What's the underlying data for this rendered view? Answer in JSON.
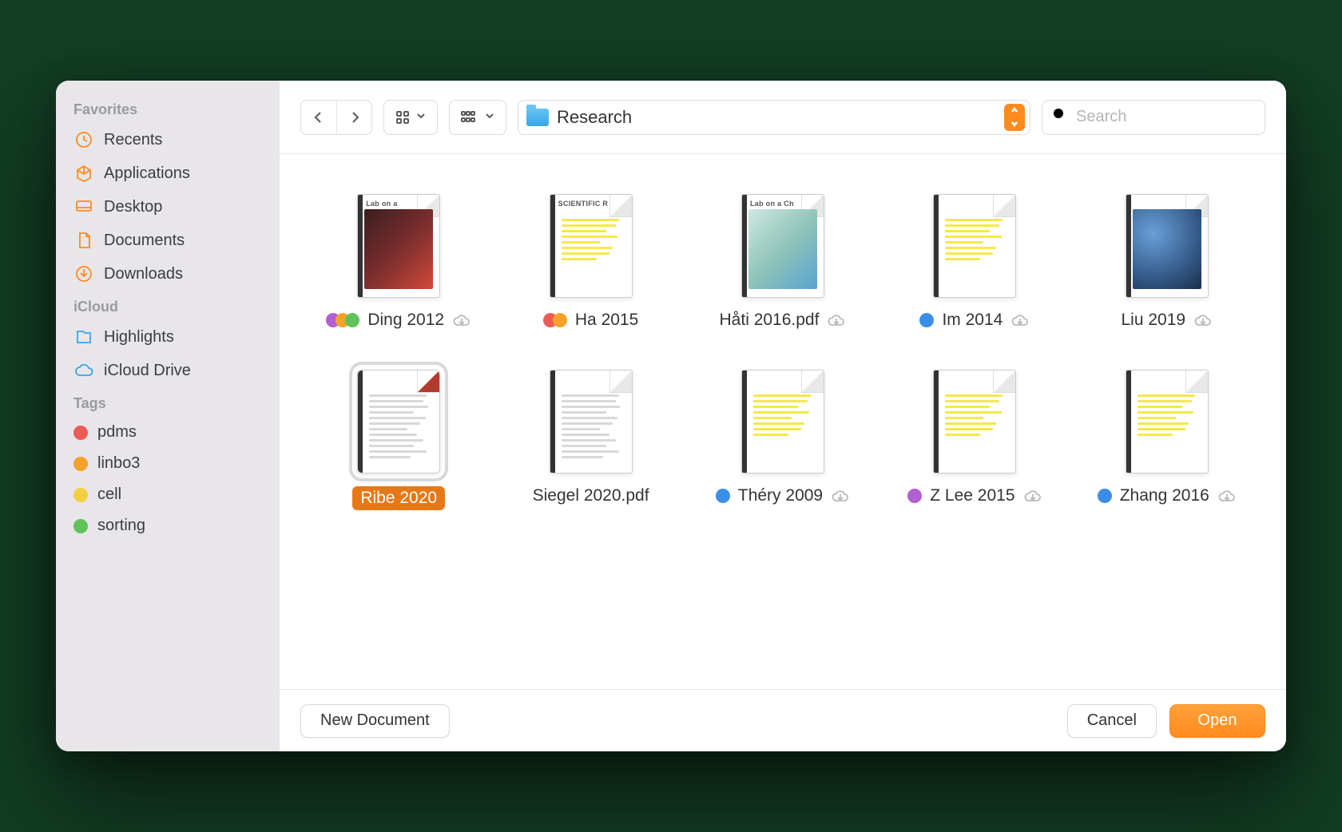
{
  "sidebar": {
    "sections": [
      {
        "title": "Favorites",
        "items": [
          {
            "icon": "clock",
            "label": "Recents"
          },
          {
            "icon": "apps",
            "label": "Applications"
          },
          {
            "icon": "desktop",
            "label": "Desktop"
          },
          {
            "icon": "doc",
            "label": "Documents"
          },
          {
            "icon": "download",
            "label": "Downloads"
          }
        ]
      },
      {
        "title": "iCloud",
        "items": [
          {
            "icon": "highlights",
            "label": "Highlights",
            "blue": true
          },
          {
            "icon": "cloud",
            "label": "iCloud Drive",
            "blue": true
          }
        ]
      },
      {
        "title": "Tags",
        "items": [
          {
            "tagColor": "#ec5b55",
            "label": "pdms"
          },
          {
            "tagColor": "#f4a22a",
            "label": "linbo3"
          },
          {
            "tagColor": "#f3cf3f",
            "label": "cell"
          },
          {
            "tagColor": "#5fc35a",
            "label": "sorting"
          }
        ]
      }
    ]
  },
  "toolbar": {
    "location": "Research",
    "searchPlaceholder": "Search"
  },
  "files": [
    {
      "name": "Ding 2012",
      "tags": [
        "#b260d1",
        "#f4a22a",
        "#5fc35a"
      ],
      "cloud": true,
      "thumbHeader": "Lab on a",
      "thumbStyle": "image",
      "imgColor": "linear-gradient(135deg,#3a1f1f,#7a2d2d,#d14a3a)"
    },
    {
      "name": "Ha 2015",
      "tags": [
        "#ec5b55",
        "#f4a22a"
      ],
      "cloud": false,
      "thumbHeader": "SCIENTIFIC R",
      "thumbStyle": "highlight"
    },
    {
      "name": "Håti 2016.pdf",
      "tags": [],
      "cloud": true,
      "thumbHeader": "Lab on a Ch",
      "thumbStyle": "image",
      "imgColor": "linear-gradient(135deg,#cfe8e3,#8fc4b8,#5aa3d0)"
    },
    {
      "name": "Im 2014",
      "tags": [
        "#3a8ee6"
      ],
      "cloud": true,
      "thumbStyle": "highlight"
    },
    {
      "name": "Liu 2019",
      "tags": [],
      "cloud": true,
      "thumbStyle": "image",
      "imgColor": "radial-gradient(circle at 30% 30%, #6aa0d8, #345b8a 60%, #1c2e4a)"
    },
    {
      "name": "Ribe 2020",
      "tags": [],
      "cloud": false,
      "thumbStyle": "plain",
      "selected": true,
      "redFold": true
    },
    {
      "name": "Siegel 2020.pdf",
      "tags": [],
      "cloud": false,
      "thumbStyle": "plain"
    },
    {
      "name": "Théry 2009",
      "tags": [
        "#3a8ee6"
      ],
      "cloud": true,
      "thumbStyle": "highlight"
    },
    {
      "name": "Z Lee 2015",
      "tags": [
        "#b260d1"
      ],
      "cloud": true,
      "thumbStyle": "highlight"
    },
    {
      "name": "Zhang 2016",
      "tags": [
        "#3a8ee6"
      ],
      "cloud": true,
      "thumbStyle": "highlight"
    }
  ],
  "footer": {
    "newDocument": "New Document",
    "cancel": "Cancel",
    "open": "Open"
  }
}
